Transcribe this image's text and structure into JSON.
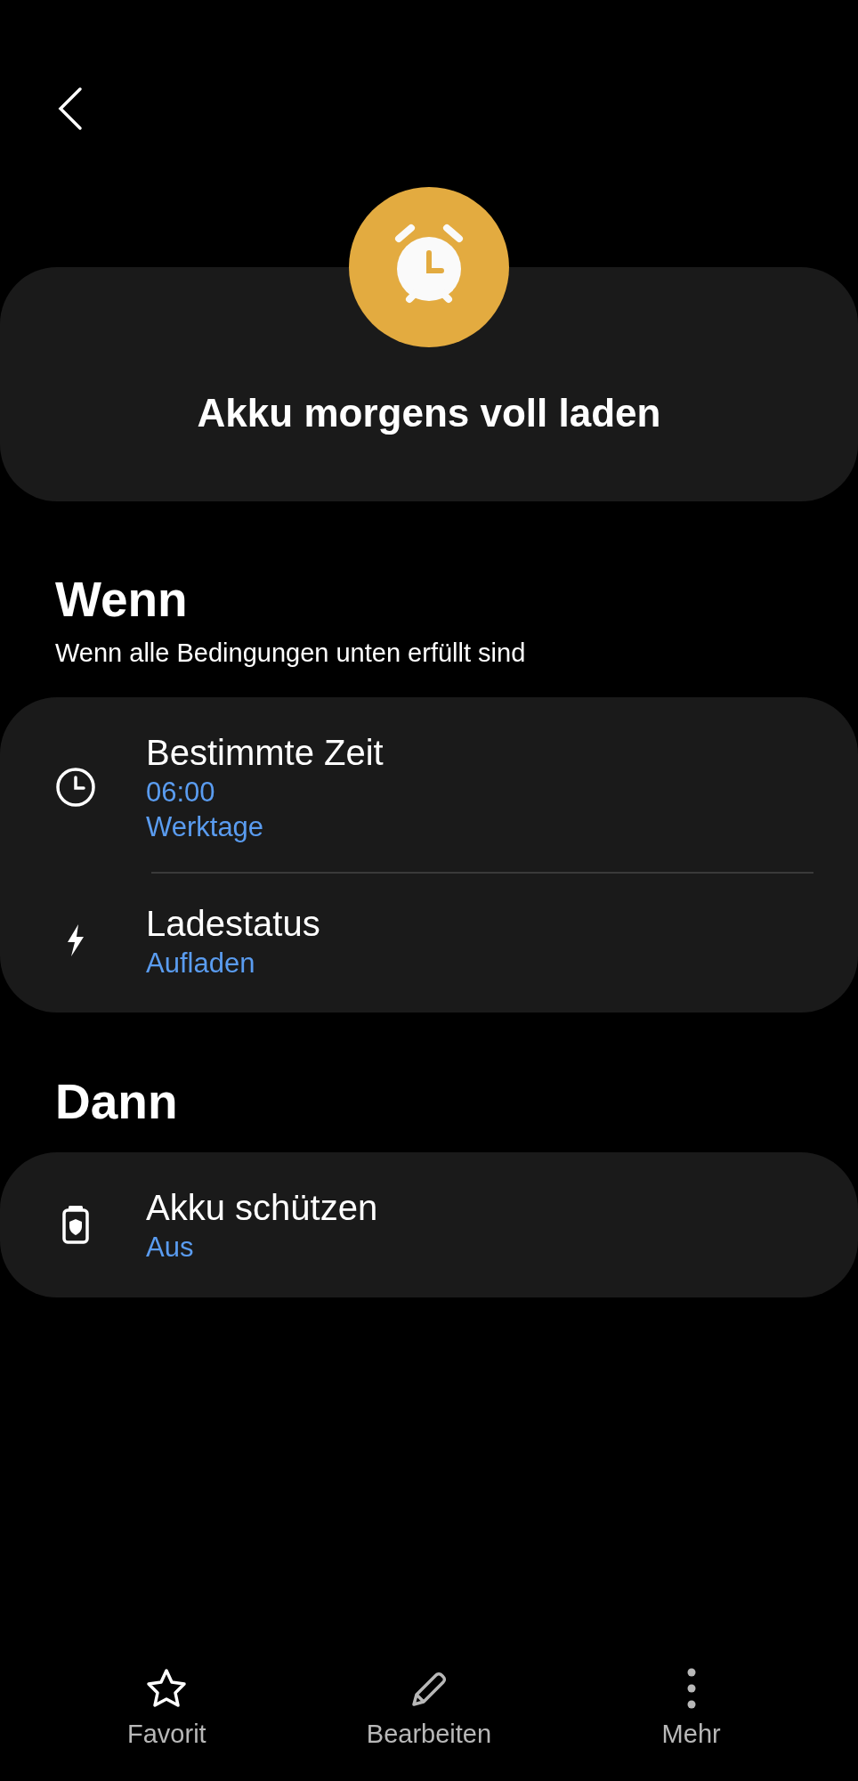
{
  "header": {
    "title": "Akku morgens voll laden"
  },
  "if_section": {
    "heading": "Wenn",
    "subtitle": "Wenn alle Bedingungen unten erfüllt sind",
    "items": [
      {
        "kind": "time",
        "title": "Bestimmte Zeit",
        "values": [
          "06:00",
          "Werktage"
        ]
      },
      {
        "kind": "charging",
        "title": "Ladestatus",
        "values": [
          "Aufladen"
        ]
      }
    ]
  },
  "then_section": {
    "heading": "Dann",
    "items": [
      {
        "kind": "battery",
        "title": "Akku schützen",
        "values": [
          "Aus"
        ]
      }
    ]
  },
  "bottom_bar": [
    {
      "kind": "favorite",
      "label": "Favorit"
    },
    {
      "kind": "edit",
      "label": "Bearbeiten"
    },
    {
      "kind": "more",
      "label": "Mehr"
    }
  ]
}
